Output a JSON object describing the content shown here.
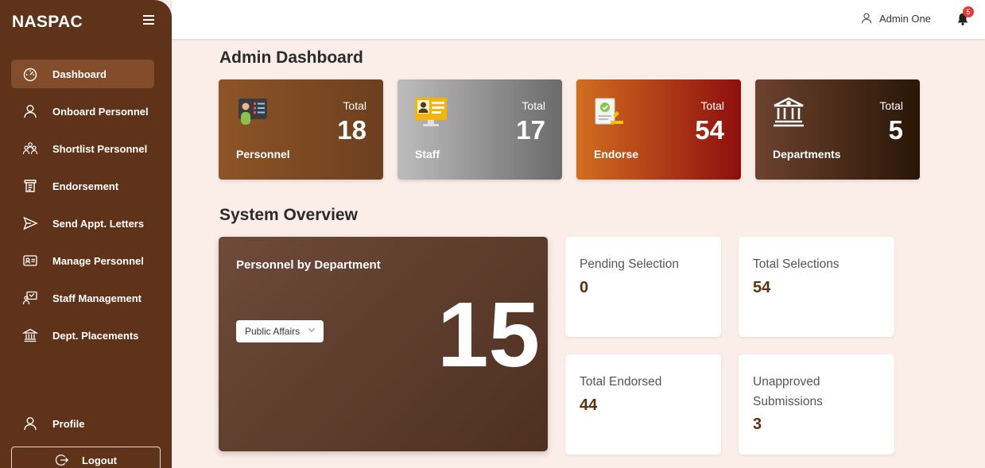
{
  "app": {
    "brand": "NASPAC"
  },
  "sidebar": {
    "items": [
      {
        "label": "Dashboard",
        "icon": "gauge-icon",
        "active": true
      },
      {
        "label": "Onboard Personnel",
        "icon": "user-icon"
      },
      {
        "label": "Shortlist Personnel",
        "icon": "group-icon"
      },
      {
        "label": "Endorsement",
        "icon": "scroll-icon"
      },
      {
        "label": "Send Appt. Letters",
        "icon": "send-icon"
      },
      {
        "label": "Manage Personnel",
        "icon": "id-card-icon"
      },
      {
        "label": "Staff Management",
        "icon": "presenter-icon"
      },
      {
        "label": "Dept. Placements",
        "icon": "building-icon"
      }
    ],
    "profile_label": "Profile",
    "logout_label": "Logout"
  },
  "header": {
    "user_name": "Admin One",
    "notification_count": "5"
  },
  "page": {
    "title": "Admin Dashboard",
    "overview_title": "System Overview"
  },
  "stats": [
    {
      "label": "Personnel",
      "total_label": "Total",
      "value": "18",
      "icon": "personnel-icon"
    },
    {
      "label": "Staff",
      "total_label": "Total",
      "value": "17",
      "icon": "staff-icon"
    },
    {
      "label": "Endorse",
      "total_label": "Total",
      "value": "54",
      "icon": "endorse-icon"
    },
    {
      "label": "Departments",
      "total_label": "Total",
      "value": "5",
      "icon": "institution-icon"
    }
  ],
  "department_panel": {
    "title": "Personnel by Department",
    "selected_department": "Public Affairs",
    "value": "15"
  },
  "overview": [
    {
      "label": "Pending Selection",
      "value": "0"
    },
    {
      "label": "Total Selections",
      "value": "54"
    },
    {
      "label": "Total Endorsed",
      "value": "44"
    },
    {
      "label": "Unapproved Submissions",
      "value": "3"
    }
  ],
  "colors": {
    "sidebar": "#5f3319",
    "active_item": "#834d2c",
    "page_background": "#fbede8",
    "value_text": "#5a3210",
    "badge": "#e53935"
  }
}
